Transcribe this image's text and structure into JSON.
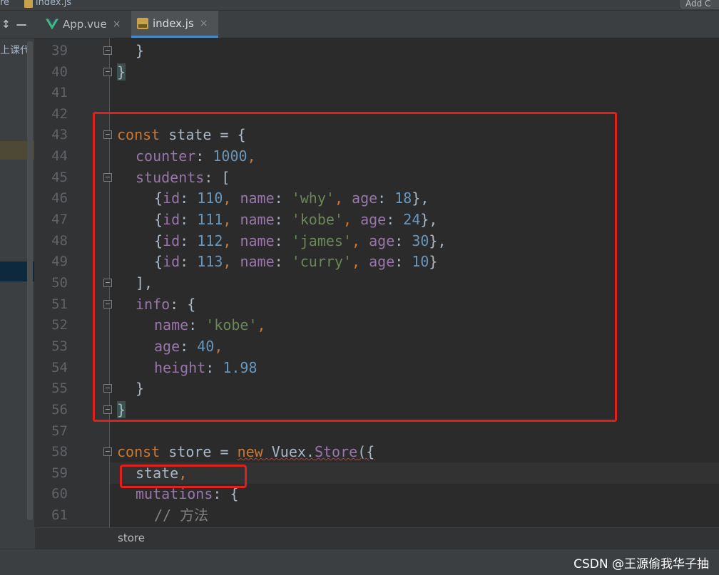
{
  "top": {
    "crumb_left": "re",
    "crumb_file": "index.js",
    "right_button": "Add C"
  },
  "tabs": [
    {
      "label": "App.vue",
      "icon": "vue-icon",
      "active": false
    },
    {
      "label": "index.js",
      "icon": "js-file-icon",
      "active": true
    }
  ],
  "tab_close_glyph": "×",
  "left_tools": [
    "↕",
    "—"
  ],
  "sidebar": {
    "label": "上课代"
  },
  "line_numbers": [
    "39",
    "40",
    "41",
    "42",
    "43",
    "44",
    "45",
    "46",
    "47",
    "48",
    "49",
    "50",
    "51",
    "52",
    "53",
    "54",
    "55",
    "56",
    "57",
    "58",
    "59",
    "60",
    "61"
  ],
  "code": {
    "l39": "}",
    "l40": "}",
    "l43_kw": "const",
    "l43_rest": " state = {",
    "l44_key": "counter",
    "l44_num": "1000",
    "l45_key": "students",
    "l45_rest": ": [",
    "students": [
      {
        "id": "110",
        "name": "'why'",
        "age": "18",
        "trail": "},"
      },
      {
        "id": "111",
        "name": "'kobe'",
        "age": "24",
        "trail": "},"
      },
      {
        "id": "112",
        "name": "'james'",
        "age": "30",
        "trail": "},"
      },
      {
        "id": "113",
        "name": "'curry'",
        "age": "10",
        "trail": "}"
      }
    ],
    "l50": "],",
    "l51_key": "info",
    "l51_rest": ": {",
    "l52_key": "name",
    "l52_str": "'kobe'",
    "l53_key": "age",
    "l53_num": "40",
    "l54_key": "height",
    "l54_num": "1.98",
    "l55": "}",
    "l56": "}",
    "l58_kw": "const",
    "l58_mid": " store = ",
    "l58_new": "new",
    "l58_vuex": " Vuex.",
    "l58_store": "Store",
    "l58_end": "({",
    "l59": "state",
    "l60_key": "mutations",
    "l60_rest": ": {",
    "l61": "// 方法"
  },
  "breadcrumb": "store",
  "watermark": "CSDN @王源偷我华子抽",
  "colors": {
    "keyword": "#cc7832",
    "property": "#9876aa",
    "number": "#6897bb",
    "string": "#6a8759",
    "annotation": "#e0201b"
  }
}
